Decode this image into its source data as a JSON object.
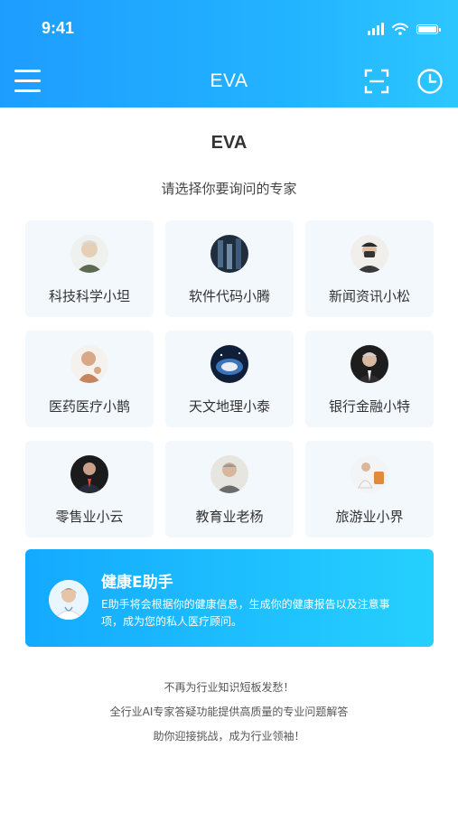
{
  "status": {
    "time": "9:41"
  },
  "nav": {
    "title": "EVA",
    "menu_icon": "menu-icon",
    "scan_icon": "scan-icon",
    "history_icon": "clock-icon"
  },
  "main": {
    "title": "EVA",
    "subtitle": "请选择你要询问的专家"
  },
  "experts": [
    {
      "label": "科技科学小坦"
    },
    {
      "label": "软件代码小腾"
    },
    {
      "label": "新闻资讯小松"
    },
    {
      "label": "医药医疗小鹊"
    },
    {
      "label": "天文地理小泰"
    },
    {
      "label": "银行金融小特"
    },
    {
      "label": "零售业小云"
    },
    {
      "label": "教育业老杨"
    },
    {
      "label": "旅游业小界"
    }
  ],
  "banner": {
    "title": "健康E助手",
    "description": "E助手将会根据你的健康信息，生成你的健康报告以及注意事项，成为您的私人医疗顾问。"
  },
  "footer": {
    "line1": "不再为行业知识短板发愁！",
    "line2": "全行业AI专家答疑功能提供高质量的专业问题解答",
    "line3": "助你迎接挑战，成为行业领袖！"
  },
  "colors": {
    "header_start": "#1e9dff",
    "header_end": "#2cc6ff",
    "card_bg": "#f3f8fd",
    "banner_start": "#14a9ff",
    "banner_end": "#25d0fd"
  }
}
